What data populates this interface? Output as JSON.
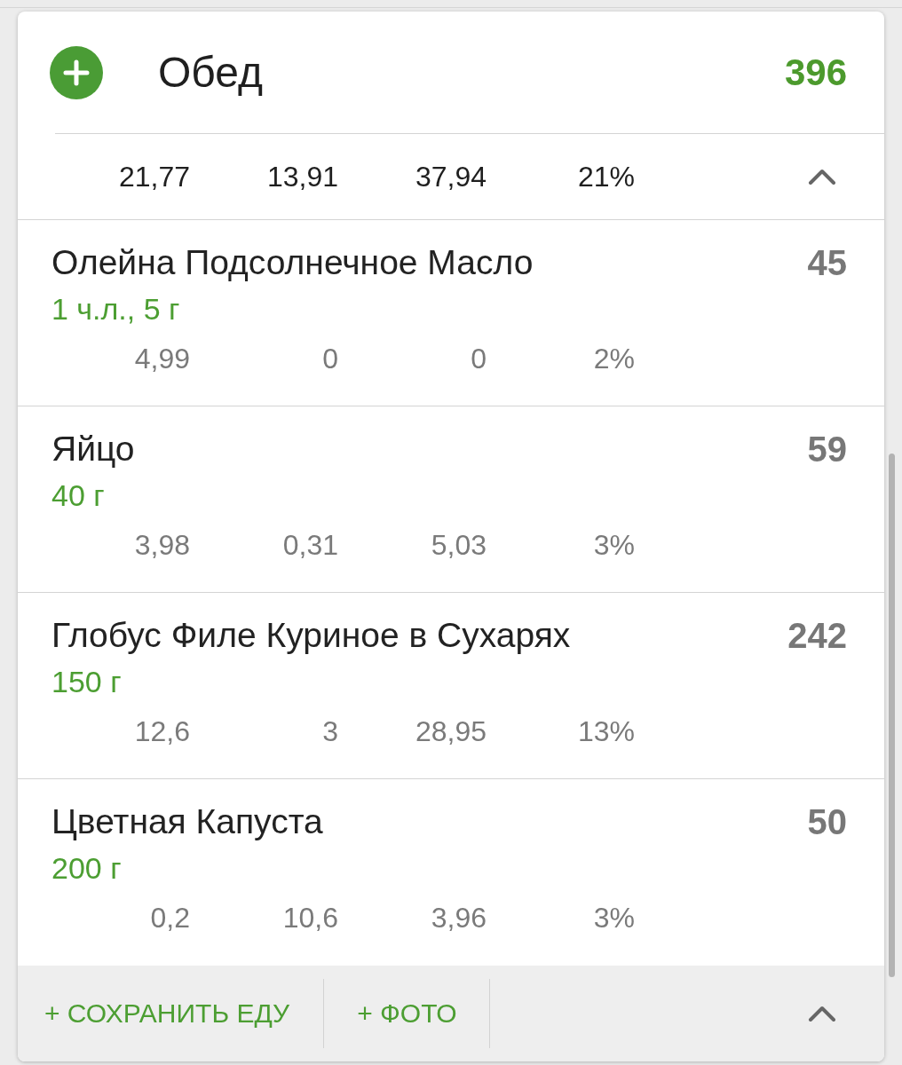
{
  "meal": {
    "title": "Обед",
    "calories": "396",
    "totals": [
      "21,77",
      "13,91",
      "37,94",
      "21%"
    ],
    "expanded": true
  },
  "items": [
    {
      "name": "Олейна Подсолнечное Масло",
      "amount": "1 ч.л., 5 г",
      "calories": "45",
      "nutrients": [
        "4,99",
        "0",
        "0",
        "2%"
      ]
    },
    {
      "name": "Яйцо",
      "amount": "40 г",
      "calories": "59",
      "nutrients": [
        "3,98",
        "0,31",
        "5,03",
        "3%"
      ]
    },
    {
      "name": "Глобус Филе Куриное в Сухарях",
      "amount": "150 г",
      "calories": "242",
      "nutrients": [
        "12,6",
        "3",
        "28,95",
        "13%"
      ]
    },
    {
      "name": "Цветная Капуста",
      "amount": "200 г",
      "calories": "50",
      "nutrients": [
        "0,2",
        "10,6",
        "3,96",
        "3%"
      ]
    }
  ],
  "footer": {
    "buttons": [
      "+ СОХРАНИТЬ ЕДУ",
      "+ ФОТО"
    ]
  }
}
